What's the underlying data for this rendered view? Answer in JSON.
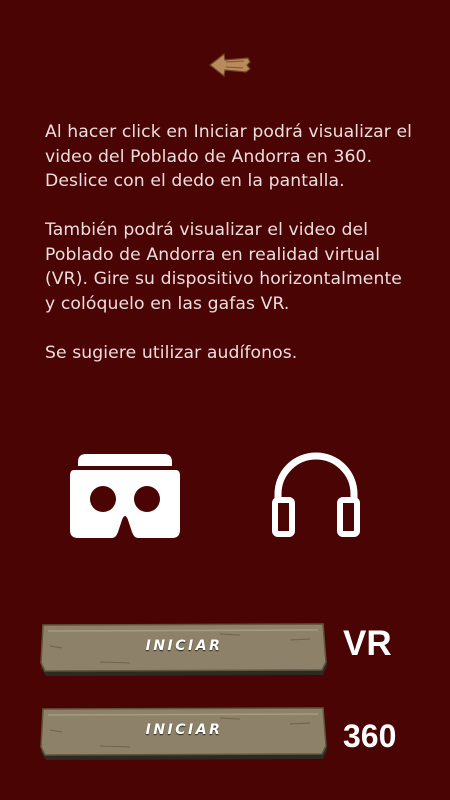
{
  "colors": {
    "background": "#4a0404",
    "text": "#ecdede",
    "button_wood": "#8d8269"
  },
  "header": {
    "back_icon": "back-arrow-icon"
  },
  "info": {
    "paragraph1": "Al hacer click en Iniciar podrá visualizar el video del Poblado de Andorra en 360. Deslice con el dedo en la pantalla.",
    "paragraph2": "También podrá visualizar el video del Poblado de Andorra en realidad virtual (VR). Gire su dispositivo horizontalmente y colóquelo en las gafas VR.",
    "paragraph3": "Se sugiere utilizar audífonos."
  },
  "icons": {
    "vr": "vr-headset-icon",
    "audio": "headphones-icon"
  },
  "buttons": [
    {
      "label": "INICIAR",
      "mode_label": "VR"
    },
    {
      "label": "INICIAR",
      "mode_label": "360"
    }
  ]
}
